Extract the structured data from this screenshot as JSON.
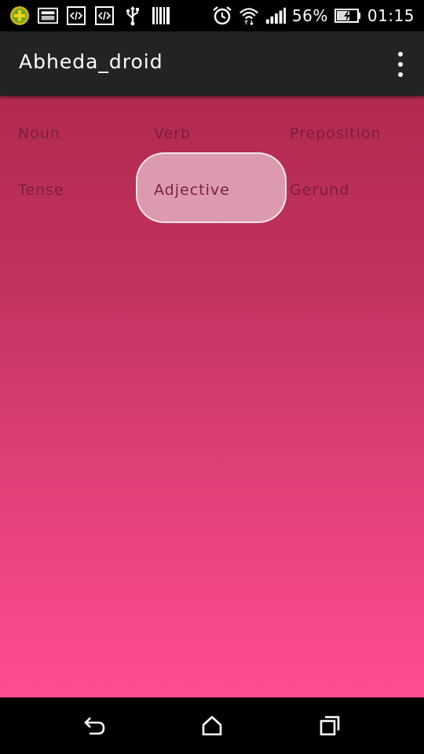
{
  "status_bar": {
    "battery_percent": "56%",
    "time": "01:15",
    "left_icons": [
      "app-plus-icon",
      "image-icon",
      "code-icon",
      "code-icon",
      "usb-icon",
      "barcode-icon"
    ],
    "right_icons": [
      "alarm-icon",
      "wifi-icon",
      "signal-icon",
      "battery-charging-icon"
    ]
  },
  "app_bar": {
    "title": "Abheda_droid",
    "menu_icon": "overflow-menu-icon"
  },
  "grid": {
    "items": [
      {
        "label": "Noun"
      },
      {
        "label": "Verb"
      },
      {
        "label": "Preposition"
      },
      {
        "label": "Tense"
      },
      {
        "label": "Adjective"
      },
      {
        "label": "Gerund"
      }
    ],
    "selected": "Adjective"
  },
  "colors": {
    "gradient_top": "#b12a4f",
    "gradient_bottom": "#ff4c93",
    "app_bar": "#232323",
    "item_text": "#7a1f3a"
  },
  "nav_bar": {
    "icons": [
      "back-icon",
      "home-icon",
      "recent-apps-icon"
    ]
  }
}
